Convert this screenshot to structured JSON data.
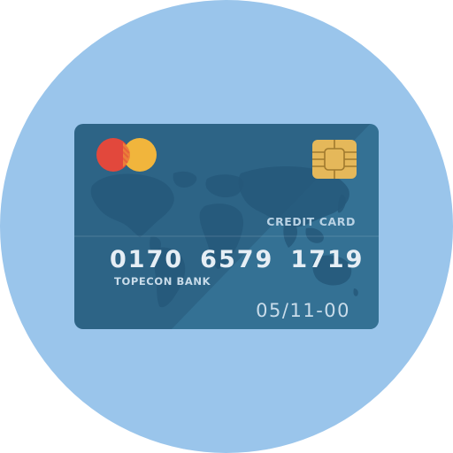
{
  "icon": {
    "name": "credit-card-icon",
    "background_color": "#9ac5eb",
    "card": {
      "color": "#2d6486",
      "shade_color": "#3a7ba0",
      "label": "CREDIT CARD",
      "number_groups": [
        "0170",
        "6579",
        "1719"
      ],
      "bank_name": "TOPECON BANK",
      "expiry": "05/11-00",
      "logo": {
        "name": "mastercard-logo",
        "colors": [
          "#e2483c",
          "#f1b53c",
          "#ec7f39"
        ]
      },
      "chip": {
        "name": "chip-icon",
        "color": "#e5b85a"
      },
      "map": {
        "name": "world-map",
        "color": "#26587a"
      }
    }
  }
}
